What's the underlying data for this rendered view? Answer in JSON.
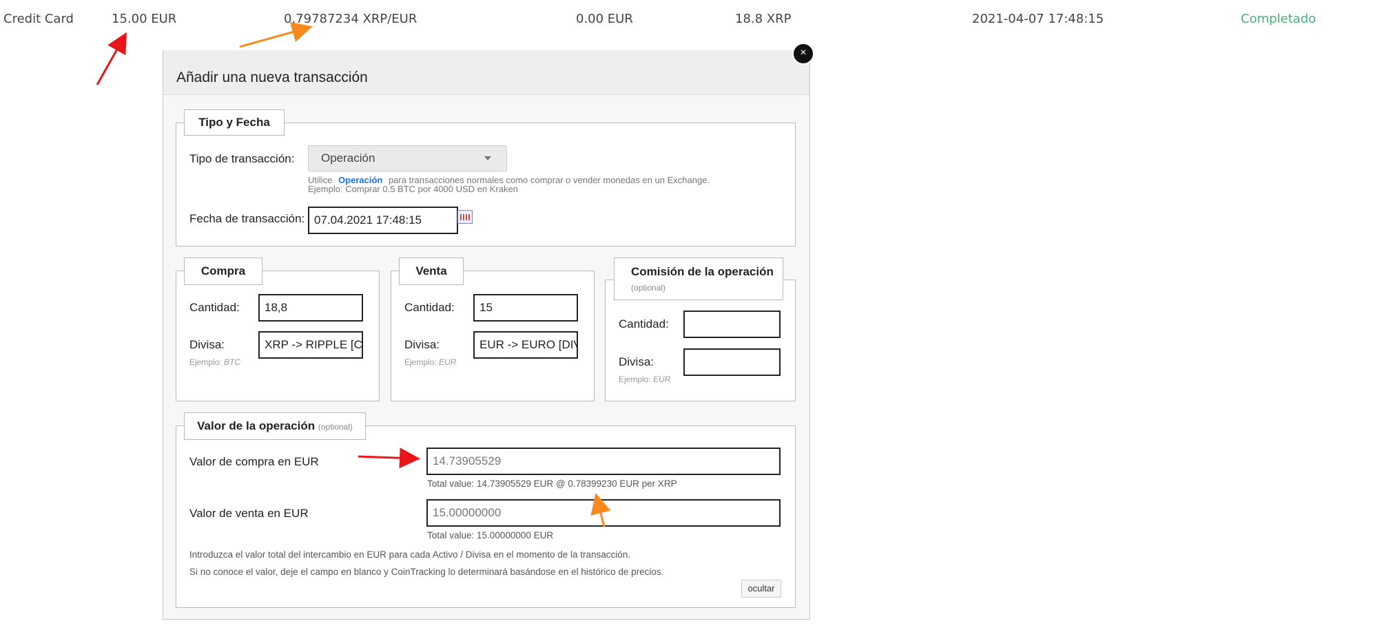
{
  "row": {
    "type": "Credit Card",
    "amount": "15.00 EUR",
    "rate": "0.79787234 XRP/EUR",
    "fee": "0.00 EUR",
    "received": "18.8 XRP",
    "date": "2021-04-07 17:48:15",
    "status": "Completado"
  },
  "modal": {
    "title": "Añadir una nueva transacción",
    "close": "×",
    "tipo_fecha": {
      "legend": "Tipo y Fecha",
      "tipo_label": "Tipo de transacción:",
      "tipo_value": "Operación",
      "hint_prefix": "Utilice",
      "hint_link": "Operación",
      "hint_suffix": "para transacciones normales como comprar o vender monedas en un Exchange.",
      "hint_example": "Ejemplo: Comprar 0.5 BTC por 4000 USD en Kraken",
      "fecha_label": "Fecha de transacción:",
      "fecha_value": "07.04.2021 17:48:15"
    },
    "compra": {
      "legend": "Compra",
      "cantidad_label": "Cantidad:",
      "cantidad_value": "18,8",
      "divisa_label": "Divisa:",
      "divisa_value": "XRP -> RIPPLE [CRYPTO]",
      "example_label": "Ejemplo:",
      "example_value": "BTC"
    },
    "venta": {
      "legend": "Venta",
      "cantidad_label": "Cantidad:",
      "cantidad_value": "15",
      "divisa_label": "Divisa:",
      "divisa_value": "EUR -> EURO [DIVISA]",
      "example_label": "Ejemplo:",
      "example_value": "EUR"
    },
    "comision": {
      "legend": "Comisión de la operación",
      "optional": "(optional)",
      "cantidad_label": "Cantidad:",
      "cantidad_value": "",
      "divisa_label": "Divisa:",
      "divisa_value": "",
      "example_label": "Ejemplo:",
      "example_value": "EUR"
    },
    "valor": {
      "legend": "Valor de la operación",
      "optional": "(optional)",
      "compra_label": "Valor de compra en EUR",
      "compra_value": "14.73905529",
      "compra_total": "Total value: 14.73905529 EUR @ 0.78399230 EUR per XRP",
      "venta_label": "Valor de venta en EUR",
      "venta_value": "15.00000000",
      "venta_total": "Total value: 15.00000000 EUR",
      "note1": "Introduzca el valor total del intercambio en EUR para cada Activo / Divisa en el momento de la transacción.",
      "note2": "Si no conoce el valor, deje el campo en blanco y CoinTracking lo determinará basándose en el histórico de precios.",
      "hide_button": "ocultar"
    }
  },
  "colors": {
    "status_green": "#4caf7a",
    "link_blue": "#1a73e8",
    "annotation_red": "#e8151b",
    "annotation_orange": "#f68a1f"
  }
}
